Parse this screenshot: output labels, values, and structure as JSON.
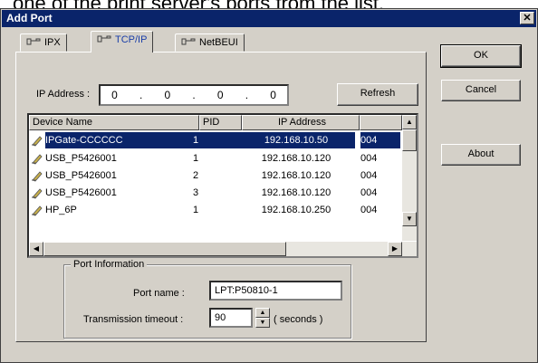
{
  "background_text": "one of the print server's ports from the list.",
  "window": {
    "title": "Add Port"
  },
  "tabs": [
    {
      "label": "IPX",
      "active": false
    },
    {
      "label": "TCP/IP",
      "active": true
    },
    {
      "label": "NetBEUI",
      "active": false
    }
  ],
  "buttons": {
    "ok": "OK",
    "cancel": "Cancel",
    "about": "About",
    "refresh": "Refresh"
  },
  "ip_address": {
    "label": "IP Address :",
    "octets": [
      "0",
      "0",
      "0",
      "0"
    ]
  },
  "device_list": {
    "columns": [
      "Device Name",
      "PID",
      "IP Address",
      ""
    ],
    "rows": [
      {
        "name": "IPGate-CCCCCC",
        "pid": "1",
        "ip": "192.168.10.50",
        "extra": "004",
        "selected": true
      },
      {
        "name": "USB_P5426001",
        "pid": "1",
        "ip": "192.168.10.120",
        "extra": "004",
        "selected": false
      },
      {
        "name": "USB_P5426001",
        "pid": "2",
        "ip": "192.168.10.120",
        "extra": "004",
        "selected": false
      },
      {
        "name": "USB_P5426001",
        "pid": "3",
        "ip": "192.168.10.120",
        "extra": "004",
        "selected": false
      },
      {
        "name": "HP_6P",
        "pid": "1",
        "ip": "192.168.10.250",
        "extra": "004",
        "selected": false
      }
    ]
  },
  "port_information": {
    "title": "Port Information",
    "port_name_label": "Port name :",
    "port_name_value": "LPT:P50810-1",
    "timeout_label": "Transmission timeout :",
    "timeout_value": "90",
    "timeout_unit": "( seconds )"
  },
  "icons": {
    "tab_icon": "network-cable-icon",
    "row_icon": "printer-icon",
    "close": "close-icon"
  },
  "colors": {
    "selection": "#0a246a",
    "face": "#d4d0c8",
    "title_bar": "#0a246a"
  }
}
